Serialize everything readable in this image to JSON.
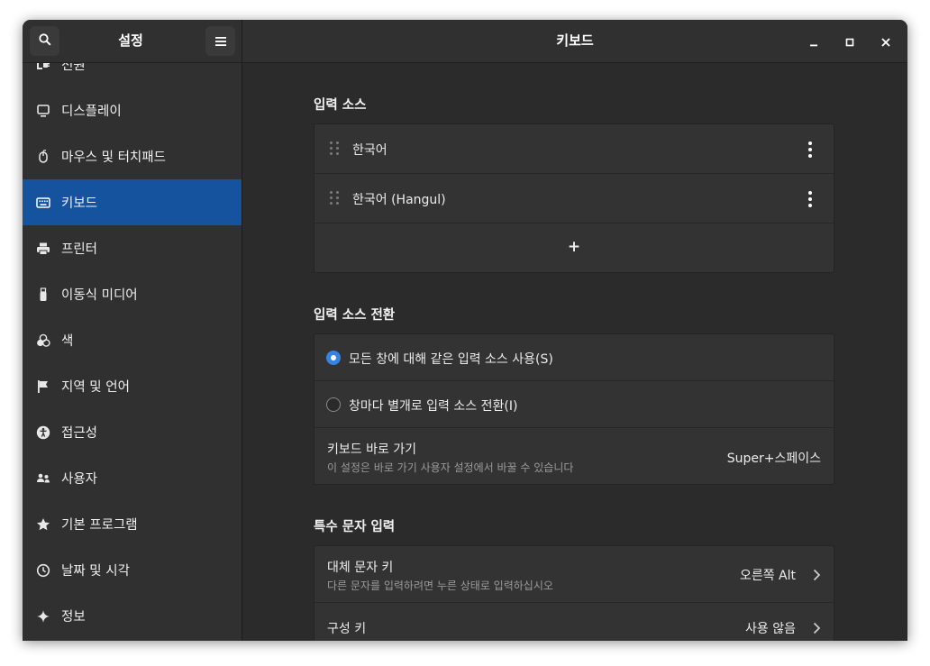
{
  "sidebar": {
    "title": "설정",
    "items": [
      {
        "label": "전원",
        "icon": "power-plug-icon"
      },
      {
        "label": "디스플레이",
        "icon": "display-icon"
      },
      {
        "label": "마우스 및 터치패드",
        "icon": "mouse-icon"
      },
      {
        "label": "키보드",
        "icon": "keyboard-icon",
        "active": true
      },
      {
        "label": "프린터",
        "icon": "printer-icon"
      },
      {
        "label": "이동식 미디어",
        "icon": "usb-drive-icon"
      },
      {
        "label": "색",
        "icon": "color-circles-icon"
      },
      {
        "label": "지역 및 언어",
        "icon": "flag-icon"
      },
      {
        "label": "접근성",
        "icon": "accessibility-icon"
      },
      {
        "label": "사용자",
        "icon": "users-icon"
      },
      {
        "label": "기본 프로그램",
        "icon": "star-icon"
      },
      {
        "label": "날짜 및 시각",
        "icon": "clock-icon"
      },
      {
        "label": "정보",
        "icon": "sparkle-icon"
      }
    ]
  },
  "header": {
    "title": "키보드"
  },
  "input_sources": {
    "title": "입력 소스",
    "items": [
      {
        "label": "한국어"
      },
      {
        "label": "한국어 (Hangul)"
      }
    ],
    "add_label": "+"
  },
  "switching": {
    "title": "입력 소스 전환",
    "option_same": "모든 창에 대해 같은 입력 소스 사용(S)",
    "option_separate": "창마다 별개로 입력 소스 전환(I)",
    "selected": "same",
    "shortcut_title": "키보드 바로 가기",
    "shortcut_subtitle": "이 설정은 바로 가기 사용자 설정에서 바꿀 수 있습니다",
    "shortcut_value": "Super+스페이스"
  },
  "special": {
    "title": "특수 문자 입력",
    "alt_title": "대체 문자 키",
    "alt_subtitle": "다른 문자를 입력하려면 누른 상태로 입력하십시오",
    "alt_value": "오른쪽 Alt",
    "compose_title": "구성 키",
    "compose_value": "사용 않음"
  },
  "colors": {
    "accent": "#3584e4",
    "selected_row": "#15539e"
  }
}
